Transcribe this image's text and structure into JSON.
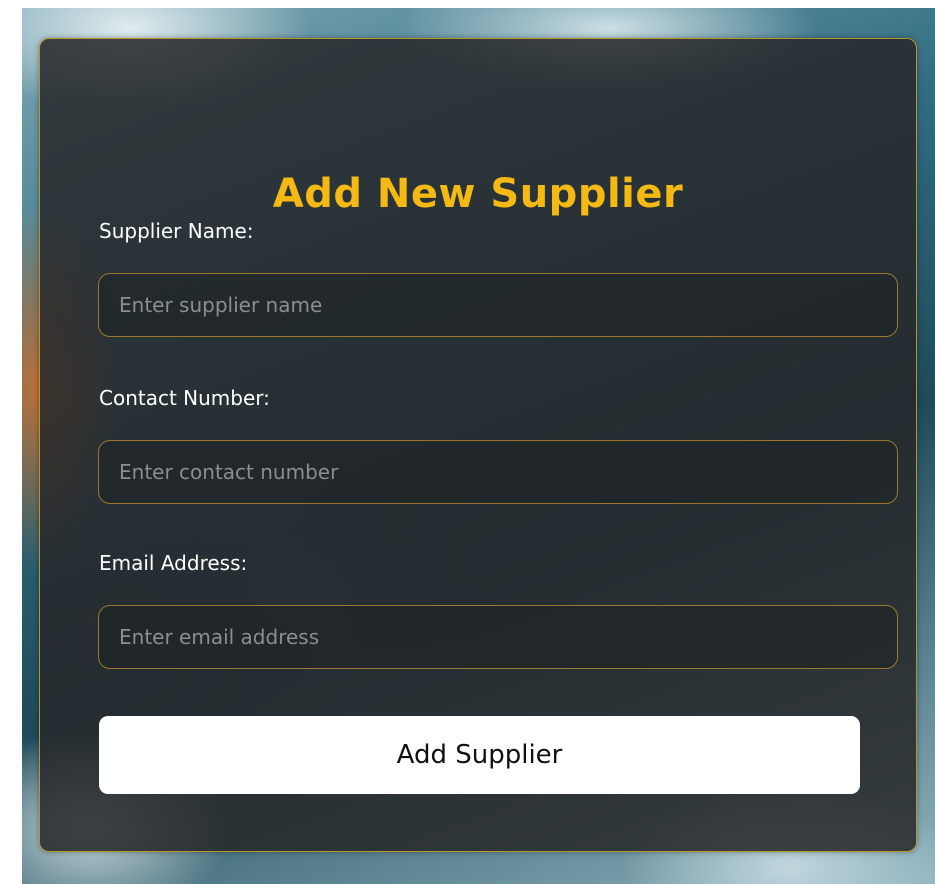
{
  "form": {
    "title": "Add New Supplier",
    "fields": [
      {
        "label": "Supplier Name:",
        "placeholder": "Enter supplier name",
        "value": ""
      },
      {
        "label": "Contact Number:",
        "placeholder": "Enter contact number",
        "value": ""
      },
      {
        "label": "Email Address:",
        "placeholder": "Enter email address",
        "value": ""
      }
    ],
    "submit_label": "Add Supplier"
  },
  "colors": {
    "accent": "#f5b914",
    "card_background": "#26282a",
    "border": "#b8962e",
    "button_background": "#ffffff"
  }
}
